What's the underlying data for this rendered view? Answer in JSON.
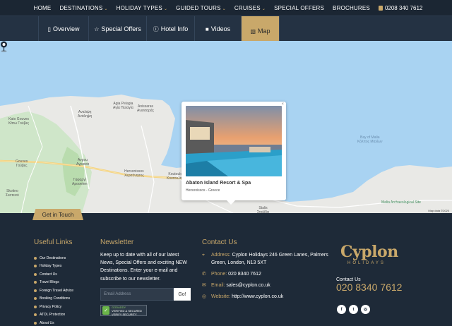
{
  "nav": {
    "items": [
      {
        "label": "HOME",
        "has_caret": false
      },
      {
        "label": "DESTINATIONS",
        "has_caret": true
      },
      {
        "label": "HOLIDAY TYPES",
        "has_caret": true
      },
      {
        "label": "GUIDED TOURS",
        "has_caret": true
      },
      {
        "label": "CRUISES",
        "has_caret": true
      },
      {
        "label": "SPECIAL OFFERS",
        "has_caret": false
      },
      {
        "label": "BROCHURES",
        "has_caret": false
      }
    ],
    "phone": "0208 340 7612",
    "caret": "⌄"
  },
  "tabs": [
    {
      "label": "Overview",
      "icon": "document-icon",
      "glyph": "▯"
    },
    {
      "label": "Special Offers",
      "icon": "star-icon",
      "glyph": "☆"
    },
    {
      "label": "Hotel Info",
      "icon": "info-icon",
      "glyph": "ⓘ"
    },
    {
      "label": "Videos",
      "icon": "video-camera-icon",
      "glyph": "■"
    },
    {
      "label": "Map",
      "icon": "map-icon",
      "glyph": "▧",
      "active": true
    }
  ],
  "map": {
    "popup": {
      "title": "Abaton Island Resort & Spa",
      "subtitle": "Hersonissos - Greece",
      "close": "×"
    },
    "labels": {
      "kato_gouves": "Kato Gouves\nΚάτω Γούβες",
      "agia_pelagia": "Agia Pelagia\nΑγία Πελαγία",
      "analipsi": "Αναλιψη\nΑνάληψη",
      "anissaras": "Anissaras\nΑνισσαράς",
      "gouves": "Gouves\nΓούβες",
      "avgou": "Avgou\nΑγριανά",
      "gafargi": "Γαφαργί\nΑρoσelen",
      "hersonissos": "Hersonissos\nΧερσόνησος",
      "koutouloufari": "Koutouloufari\nΚουτουλουφάρι",
      "skotino": "Skotino\nΣκοτεινό",
      "stalis": "Stalis\nΣταλίδα",
      "bay_of_malia": "Bay of Malia\nΚόλπος Μαλίων",
      "malia_museum": "Malia Archaeological Site",
      "credit": "Map data ©2020"
    }
  },
  "get_in_touch": "Get in Touch",
  "footer": {
    "useful_links_title": "Useful Links",
    "links": [
      "Our Destinations",
      "Holiday Types",
      "Contact Us",
      "Travel Blogs",
      "Foreign Travel Advice",
      "Booking Conditions",
      "Privacy Policy",
      "ATOL Protection",
      "About Us"
    ],
    "newsletter_title": "Newsletter",
    "newsletter_text": "Keep up to date with all of our latest News, Special Offers and exciting NEW Destinations. Enter your e-mail and subscribe to our newsletter.",
    "email_placeholder": "Email Address",
    "go_label": "Go!",
    "badge_line1": "GODADDY",
    "badge_line2": "VERIFIED & SECURED",
    "badge_line3": "VERIFY SECURITY",
    "contact_title": "Contact Us",
    "contact": [
      {
        "label": "Address:",
        "value": "Cyplon Holidays 246 Green Lanes, Palmers Green, London, N13 5XT",
        "icon": "location-pin-icon",
        "glyph": "⌖"
      },
      {
        "label": "Phone:",
        "value": "020 8340 7612",
        "icon": "phone-icon",
        "glyph": "✆"
      },
      {
        "label": "Email:",
        "value": "sales@cyplon.co.uk",
        "icon": "envelope-icon",
        "glyph": "✉"
      },
      {
        "label": "Website:",
        "value": "http://www.cyplon.co.uk",
        "icon": "globe-icon",
        "glyph": "◎"
      }
    ],
    "logo_name": "Cyplon",
    "logo_tag": "HOLIDAYS",
    "contact_us_label": "Contact Us",
    "contact_phone": "020 8340 7612",
    "social": [
      {
        "icon": "facebook-icon",
        "glyph": "f"
      },
      {
        "icon": "twitter-icon",
        "glyph": "t"
      },
      {
        "icon": "instagram-icon",
        "glyph": "◎"
      }
    ]
  },
  "colors": {
    "gold": "#c9a86a",
    "navy": "#1e2a38",
    "sea": "#a9d3f2"
  }
}
